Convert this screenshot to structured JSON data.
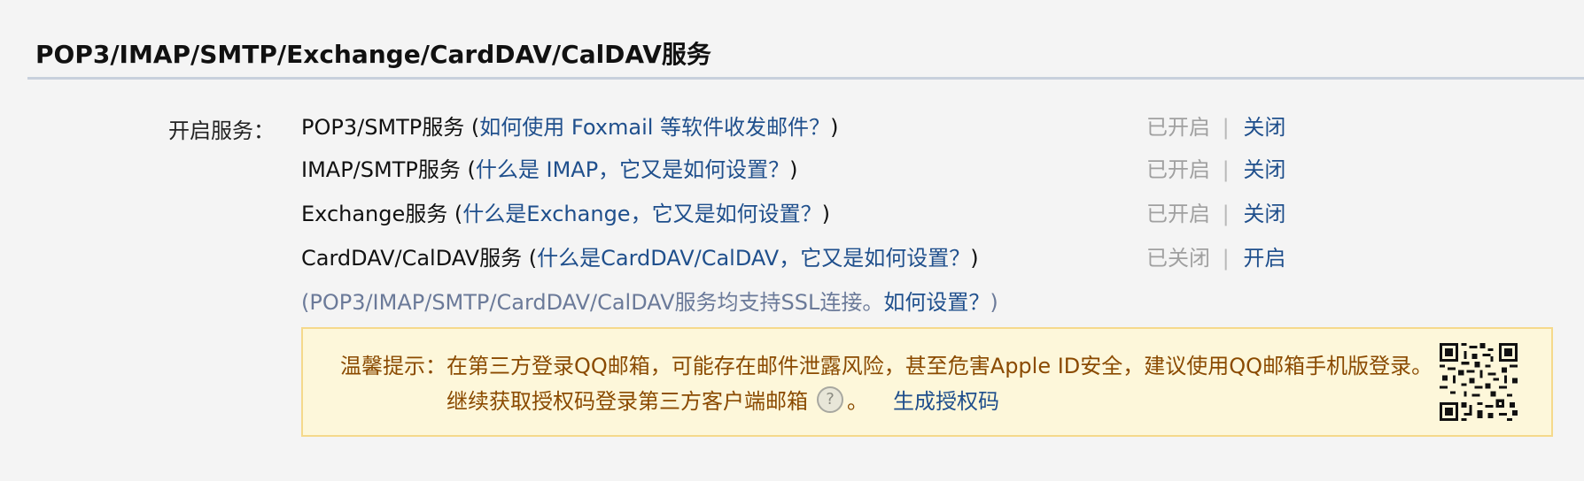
{
  "section": {
    "title": "POP3/IMAP/SMTP/Exchange/CardDAV/CalDAV服务"
  },
  "services_label": "开启服务：",
  "services": [
    {
      "name": "POP3/SMTP服务",
      "help": "如何使用 Foxmail 等软件收发邮件？",
      "state": "已开启",
      "action": "关闭"
    },
    {
      "name": "IMAP/SMTP服务",
      "help": "什么是 IMAP，它又是如何设置？",
      "state": "已开启",
      "action": "关闭"
    },
    {
      "name": "Exchange服务",
      "help": "什么是Exchange，它又是如何设置？",
      "state": "已开启",
      "action": "关闭"
    },
    {
      "name": "CardDAV/CalDAV服务",
      "help": "什么是CardDAV/CalDAV，它又是如何设置？",
      "state": "已关闭",
      "action": "开启"
    }
  ],
  "separator": "|",
  "ssl_note": {
    "text": "(POP3/IMAP/SMTP/CardDAV/CalDAV服务均支持SSL连接。",
    "link": "如何设置？",
    "close": ")"
  },
  "tip": {
    "label": "温馨提示：",
    "line1": "在第三方登录QQ邮箱，可能存在邮件泄露风险，甚至危害Apple ID安全，建议使用QQ邮箱手机版登录。",
    "line2": "继续获取授权码登录第三方客户端邮箱",
    "help_icon": "question-icon",
    "help_glyph": "?",
    "period": "。",
    "generate_link": "生成授权码"
  },
  "colors": {
    "link": "#1f4f8c",
    "tip_text": "#8a4a00",
    "tip_bg": "#fdf7da",
    "tip_border": "#f5d98b",
    "muted": "#a0a0a0"
  }
}
